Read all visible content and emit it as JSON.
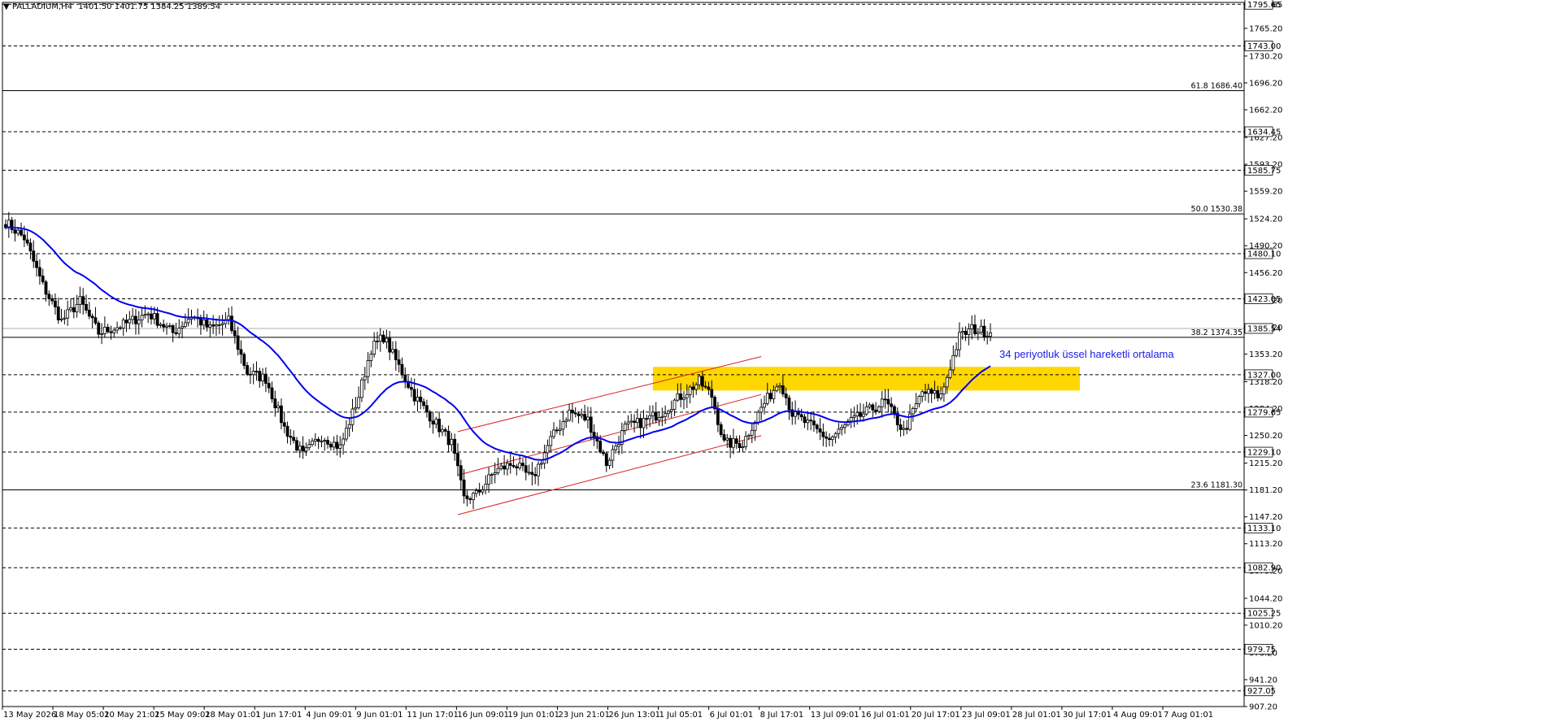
{
  "header": {
    "symbol": "PALLADIUM,H4",
    "ohlc": "1401.50 1401.75 1384.25 1389.54"
  },
  "chart_data": {
    "type": "candlestick",
    "title": "PALLADIUM,H4",
    "ylim": [
      907.2,
      1798
    ],
    "y_ticks": [
      "1795.65",
      "1765.20",
      "1730.20",
      "1696.20",
      "1662.20",
      "1627.20",
      "1593.20",
      "1559.20",
      "1524.20",
      "1490.20",
      "1456.20",
      "1421.20",
      "1387.20",
      "1353.20",
      "1318.20",
      "1284.20",
      "1250.20",
      "1215.20",
      "1181.20",
      "1147.20",
      "1113.20",
      "1079.20",
      "1044.20",
      "1010.20",
      "975.20",
      "941.20",
      "907.20"
    ],
    "x_ticks": [
      "13 May 2026",
      "18 May 05:01",
      "20 May 21:01",
      "25 May 09:01",
      "28 May 01:01",
      "1 Jun 17:01",
      "4 Jun 09:01",
      "9 Jun 01:01",
      "11 Jun 17:01",
      "16 Jun 09:01",
      "19 Jun 01:01",
      "23 Jun 21:01",
      "26 Jun 13:01",
      "1 Jul 05:01",
      "6 Jul 01:01",
      "8 Jul 17:01",
      "13 Jul 09:01",
      "16 Jul 01:01",
      "20 Jul 17:01",
      "23 Jul 09:01",
      "28 Jul 01:01",
      "30 Jul 17:01",
      "4 Aug 09:01",
      "7 Aug 01:01"
    ],
    "price_anchors": [
      [
        0,
        1520
      ],
      [
        6,
        1500
      ],
      [
        12,
        1440
      ],
      [
        18,
        1395
      ],
      [
        24,
        1420
      ],
      [
        30,
        1380
      ],
      [
        38,
        1390
      ],
      [
        46,
        1405
      ],
      [
        54,
        1380
      ],
      [
        60,
        1402
      ],
      [
        66,
        1385
      ],
      [
        72,
        1395
      ],
      [
        78,
        1330
      ],
      [
        84,
        1322
      ],
      [
        90,
        1260
      ],
      [
        96,
        1225
      ],
      [
        102,
        1250
      ],
      [
        108,
        1235
      ],
      [
        114,
        1300
      ],
      [
        118,
        1360
      ],
      [
        122,
        1375
      ],
      [
        126,
        1345
      ],
      [
        132,
        1300
      ],
      [
        138,
        1270
      ],
      [
        144,
        1240
      ],
      [
        148,
        1170
      ],
      [
        152,
        1175
      ],
      [
        158,
        1205
      ],
      [
        164,
        1215
      ],
      [
        170,
        1195
      ],
      [
        176,
        1245
      ],
      [
        182,
        1280
      ],
      [
        188,
        1270
      ],
      [
        194,
        1215
      ],
      [
        200,
        1260
      ],
      [
        206,
        1268
      ],
      [
        212,
        1280
      ],
      [
        218,
        1300
      ],
      [
        224,
        1318
      ],
      [
        228,
        1300
      ],
      [
        232,
        1240
      ],
      [
        238,
        1240
      ],
      [
        244,
        1285
      ],
      [
        250,
        1320
      ],
      [
        254,
        1278
      ],
      [
        260,
        1262
      ],
      [
        266,
        1245
      ],
      [
        272,
        1265
      ],
      [
        278,
        1280
      ],
      [
        284,
        1293
      ],
      [
        290,
        1255
      ],
      [
        296,
        1305
      ],
      [
        302,
        1300
      ],
      [
        308,
        1375
      ],
      [
        312,
        1385
      ],
      [
        318,
        1380
      ]
    ],
    "ema": {
      "name": "34 periyotluk üssel hareketli ortalama",
      "period": 34,
      "color": "#0000ee"
    },
    "horizontal_levels": [
      {
        "value": 1795.65,
        "label": "1795.65",
        "style": "dashed"
      },
      {
        "value": 1743.0,
        "label": "1743.00",
        "style": "dashed"
      },
      {
        "value": 1634.45,
        "label": "1634.45",
        "style": "dashed"
      },
      {
        "value": 1585.75,
        "label": "1585.75",
        "style": "dashed"
      },
      {
        "value": 1480.1,
        "label": "1480.10",
        "style": "dashed"
      },
      {
        "value": 1423.05,
        "label": "1423.05",
        "style": "dashed"
      },
      {
        "value": 1327.0,
        "label": "1327.00",
        "style": "dashed"
      },
      {
        "value": 1279.65,
        "label": "1279.65",
        "style": "dashed"
      },
      {
        "value": 1229.1,
        "label": "1229.10",
        "style": "dashed"
      },
      {
        "value": 1133.1,
        "label": "1133.10",
        "style": "dashed"
      },
      {
        "value": 1082.9,
        "label": "1082.90",
        "style": "dashed"
      },
      {
        "value": 1025.25,
        "label": "1025.25",
        "style": "dashed"
      },
      {
        "value": 979.75,
        "label": "979.75",
        "style": "dashed"
      },
      {
        "value": 927.05,
        "label": "927.05",
        "style": "dashed"
      }
    ],
    "fibonacci": [
      {
        "value": 1686.4,
        "label": "61.8 1686.40"
      },
      {
        "value": 1530.38,
        "label": "50.0 1530.38"
      },
      {
        "value": 1374.35,
        "label": "38.2 1374.35"
      },
      {
        "value": 1181.3,
        "label": "23.6 1181.30"
      }
    ],
    "current_price": {
      "value": 1385.54,
      "label": "1385.54"
    },
    "zone": {
      "from_bar": 209,
      "to_bar": 999,
      "low": 1307,
      "high": 1337,
      "color": "#ffd700"
    },
    "channel": [
      {
        "x1": 146,
        "y1": 1255,
        "x2": 244,
        "y2": 1350
      },
      {
        "x1": 146,
        "y1": 1200,
        "x2": 244,
        "y2": 1302
      },
      {
        "x1": 146,
        "y1": 1150,
        "x2": 244,
        "y2": 1250
      }
    ],
    "channel_color": "#dd2020",
    "annotation": "34 periyotluk üssel hareketli ortalama"
  }
}
